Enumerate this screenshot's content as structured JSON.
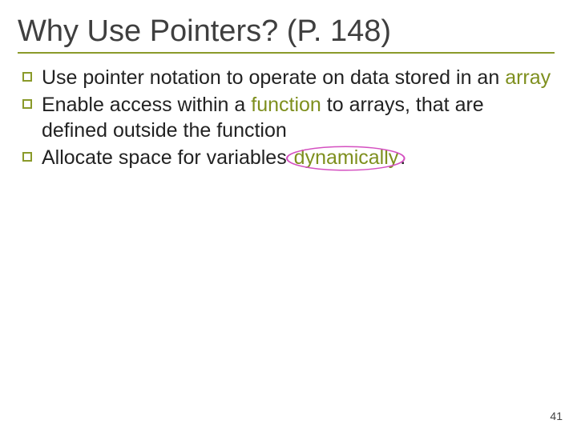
{
  "title": "Why Use Pointers? (P. 148)",
  "bullets": {
    "b1a": "Use pointer notation to operate on data stored in an ",
    "b1_hl": "array",
    "b2a": "Enable access within a ",
    "b2_hl": "function",
    "b2b": " to arrays, that are defined outside the function",
    "b3a": "Allocate space for variables ",
    "b3_hl": "dynamically",
    "b3b": "."
  },
  "pagenum": "41"
}
